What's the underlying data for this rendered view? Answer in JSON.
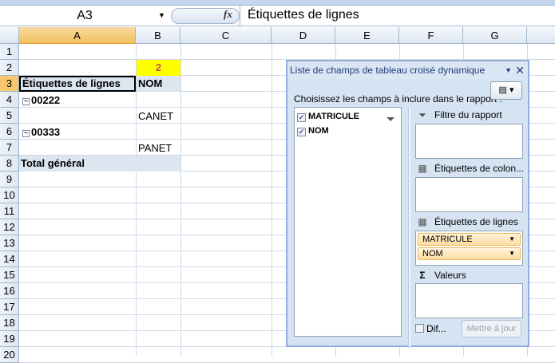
{
  "formula_bar": {
    "name_box": "A3",
    "fx": "fx",
    "value": "Étiquettes de lignes"
  },
  "columns": [
    "A",
    "B",
    "C",
    "D",
    "E",
    "F",
    "G"
  ],
  "rows": [
    "1",
    "2",
    "3",
    "4",
    "5",
    "6",
    "7",
    "8",
    "9",
    "10",
    "11",
    "12",
    "13",
    "14",
    "15",
    "16",
    "17",
    "18",
    "19",
    "20"
  ],
  "cells": {
    "B2": "2",
    "A3": "Étiquettes de lignes",
    "B3": "NOM",
    "A4": "00222",
    "B5": "CANET",
    "A6": "00333",
    "B7": "PANET",
    "A8": "Total général"
  },
  "colors": {
    "highlight": "#ffff00",
    "highlight_text": "#c0504d",
    "pivot_header": "#dce6f1",
    "accent": "#1f3c78"
  },
  "panel": {
    "title": "Liste de champs de tableau croisé dynamique",
    "choose_label": "Choisissez les champs à inclure dans le rapport :",
    "fields": [
      {
        "label": "MATRICULE",
        "checked": true
      },
      {
        "label": "NOM",
        "checked": true
      }
    ],
    "areas": {
      "filter": "Filtre du rapport",
      "columns": "Étiquettes de colon...",
      "rows": "Étiquettes de lignes",
      "values": "Valeurs"
    },
    "row_fields": [
      "MATRICULE",
      "NOM"
    ],
    "defer_label": "Dif...",
    "update_button": "Mettre à jour"
  }
}
